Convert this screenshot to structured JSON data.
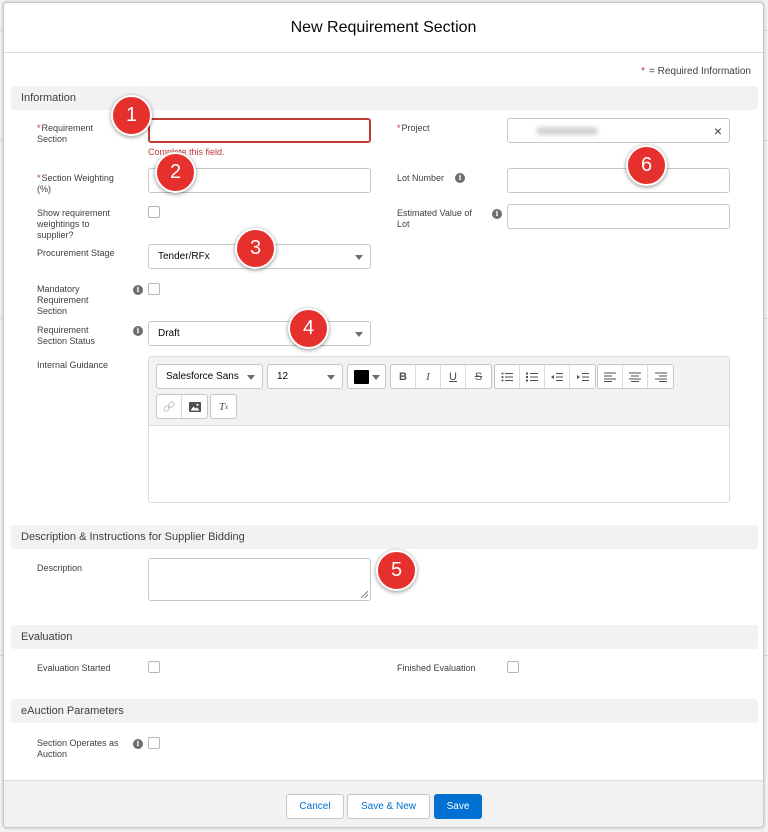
{
  "modal": {
    "title": "New Requirement Section",
    "required_info": "= Required Information"
  },
  "sections": {
    "information": "Information",
    "description": "Description & Instructions for Supplier Bidding",
    "evaluation": "Evaluation",
    "eauction": "eAuction Parameters"
  },
  "fields": {
    "requirement_section": {
      "label_line1": "Requirement",
      "label_line2": "Section",
      "value": "",
      "error": "Complete this field."
    },
    "project": {
      "label": "Project",
      "value_blurred": true
    },
    "section_weighting": {
      "label_line1": "Section Weighting",
      "label_line2": "(%)",
      "value": ""
    },
    "lot_number": {
      "label": "Lot Number",
      "value": ""
    },
    "show_weightings": {
      "label_line1": "Show requirement",
      "label_line2": "weightings to",
      "label_line3": "supplier?",
      "checked": false
    },
    "estimated_value": {
      "label_line1": "Estimated Value of",
      "label_line2": "Lot",
      "value": ""
    },
    "procurement_stage": {
      "label": "Procurement Stage",
      "value": "Tender/RFx"
    },
    "mandatory_section": {
      "label_line1": "Mandatory",
      "label_line2": "Requirement",
      "label_line3": "Section",
      "checked": false
    },
    "section_status": {
      "label_line1": "Requirement",
      "label_line2": "Section Status",
      "value": "Draft"
    },
    "internal_guidance": {
      "label": "Internal Guidance",
      "font_family": "Salesforce Sans",
      "font_size": "12",
      "text_color": "#000000"
    },
    "description": {
      "label": "Description",
      "value": ""
    },
    "evaluation_started": {
      "label": "Evaluation Started",
      "checked": false
    },
    "finished_evaluation": {
      "label": "Finished Evaluation",
      "checked": false
    },
    "operates_as_auction": {
      "label_line1": "Section Operates as",
      "label_line2": "Auction",
      "checked": false
    }
  },
  "markers": [
    "1",
    "2",
    "3",
    "4",
    "5",
    "6"
  ],
  "footer": {
    "cancel": "Cancel",
    "save_new": "Save & New",
    "save": "Save"
  },
  "colors": {
    "brand": "#0070d2",
    "error": "#c23934",
    "marker": "#e5302e"
  }
}
